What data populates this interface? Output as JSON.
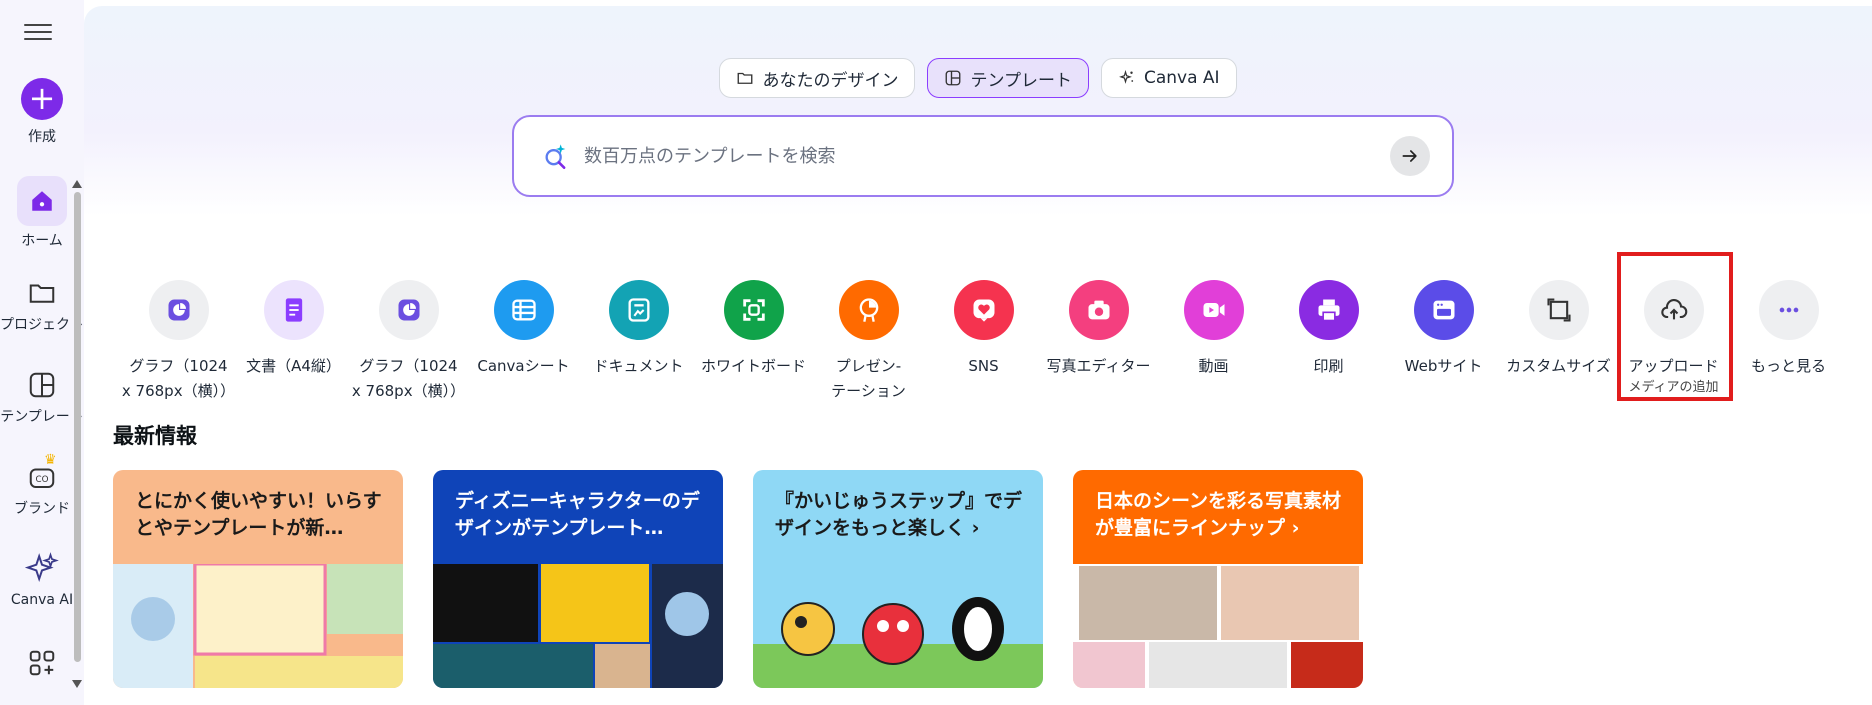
{
  "sidebar": {
    "create_label": "作成",
    "items": [
      {
        "label": "ホーム",
        "icon": "home-icon"
      },
      {
        "label": "プロジェクト",
        "icon": "folder-icon"
      },
      {
        "label": "テンプレート",
        "icon": "template-icon"
      },
      {
        "label": "ブランド",
        "icon": "brand-icon"
      },
      {
        "label": "Canva AI",
        "icon": "sparkle-icon"
      },
      {
        "label": "",
        "icon": "apps-icon"
      }
    ]
  },
  "hero": {
    "tabs": [
      {
        "label": "あなたのデザイン",
        "icon": "folder-icon",
        "active": false
      },
      {
        "label": "テンプレート",
        "icon": "template-icon",
        "active": true
      },
      {
        "label": "Canva AI",
        "icon": "sparkle-icon",
        "active": false
      }
    ],
    "search": {
      "placeholder": "数百万点のテンプレートを検索"
    }
  },
  "shortcuts": [
    {
      "line1": "グラフ（1024",
      "line2": "x 768px（横））",
      "color": "#eeeff1",
      "icon_color": "#6b4fe0",
      "icon": "chart-icon"
    },
    {
      "line1": "文書（A4縦）",
      "line2": "",
      "color": "#ece3fd",
      "icon_color": "#8b3dff",
      "icon": "doc-icon"
    },
    {
      "line1": "グラフ（1024",
      "line2": "x 768px（横））",
      "color": "#eeeff1",
      "icon_color": "#6b4fe0",
      "icon": "chart-icon"
    },
    {
      "line1": "Canvaシート",
      "line2": "",
      "color": "#1e9bf0",
      "icon_color": "#ffffff",
      "icon": "sheet-icon"
    },
    {
      "line1": "ドキュメント",
      "line2": "",
      "color": "#13a3b4",
      "icon_color": "#ffffff",
      "icon": "document-icon"
    },
    {
      "line1": "ホワイトボード",
      "line2": "",
      "color": "#10a34a",
      "icon_color": "#ffffff",
      "icon": "whiteboard-icon"
    },
    {
      "line1": "プレゼン-",
      "line2": "テーション",
      "color": "#ff6a00",
      "icon_color": "#ffffff",
      "icon": "presentation-icon"
    },
    {
      "line1": "SNS",
      "line2": "",
      "color": "#f5334f",
      "icon_color": "#ffffff",
      "icon": "heart-icon"
    },
    {
      "line1": "写真エディター",
      "line2": "",
      "color": "#f43f7f",
      "icon_color": "#ffffff",
      "icon": "camera-icon"
    },
    {
      "line1": "動画",
      "line2": "",
      "color": "#e13fd8",
      "icon_color": "#ffffff",
      "icon": "video-icon"
    },
    {
      "line1": "印刷",
      "line2": "",
      "color": "#8a2be2",
      "icon_color": "#ffffff",
      "icon": "print-icon"
    },
    {
      "line1": "Webサイト",
      "line2": "",
      "color": "#5b4ce8",
      "icon_color": "#ffffff",
      "icon": "website-icon"
    },
    {
      "line1": "カスタムサイズ",
      "line2": "",
      "color": "#eeeff1",
      "icon_color": "#333333",
      "icon": "resize-icon"
    },
    {
      "line1": "アップロード",
      "line2": "メディアの追加",
      "color": "#eeeff1",
      "icon_color": "#333333",
      "icon": "upload-cloud-icon"
    },
    {
      "line1": "もっと見る",
      "line2": "",
      "color": "#eeeff1",
      "icon_color": "#6b4fe0",
      "icon": "more-icon"
    }
  ],
  "news": {
    "heading": "最新情報",
    "cards": [
      {
        "title": "とにかく使いやすい！いらすとやテンプレートが新…",
        "bg": "#f9b98b",
        "text_color": "#1a1a1a"
      },
      {
        "title": "ディズニーキャラクターのデザインがテンプレート…",
        "bg": "#0f44b8",
        "text_color": "#ffffff"
      },
      {
        "title": "『かいじゅうステップ』でデザインをもっと楽しく ›",
        "bg": "#8fd8f5",
        "text_color": "#1a1a1a"
      },
      {
        "title": "日本のシーンを彩る写真素材が豊富にラインナップ ›",
        "bg": "#ff6a00",
        "text_color": "#ffffff"
      }
    ]
  }
}
